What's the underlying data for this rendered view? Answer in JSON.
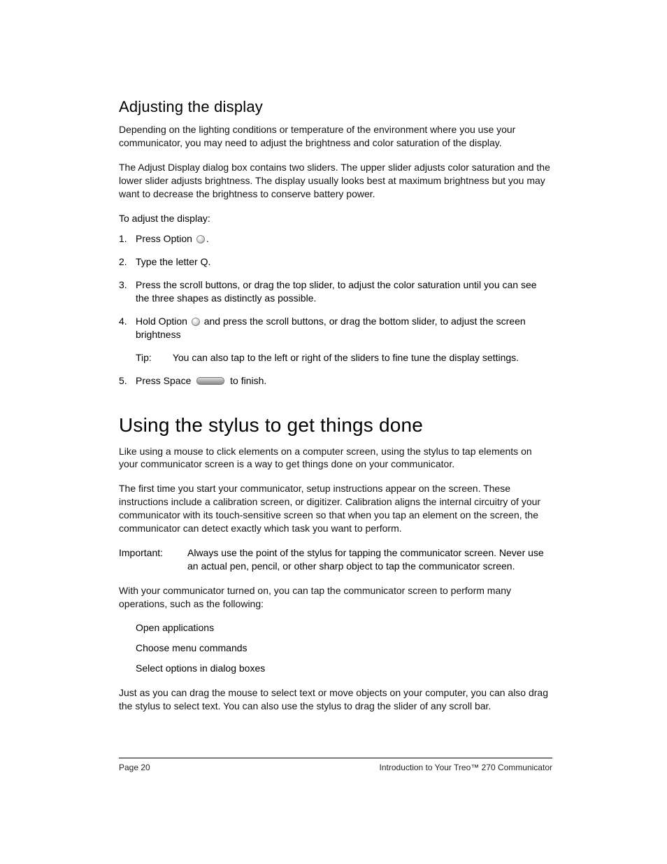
{
  "section": {
    "title": "Adjusting the display",
    "para1": "Depending on the lighting conditions or temperature of the environment where you use your communicator, you may need to adjust the brightness and color saturation of the display.",
    "para2": "The Adjust Display dialog box contains two sliders. The upper slider adjusts color saturation and the lower slider adjusts brightness. The display usually looks best at maximum brightness but you may want to decrease the brightness to conserve battery power.",
    "subhead": "To adjust the display:",
    "steps": {
      "s1a": "Press Option ",
      "s1b": ".",
      "s2": "Type the letter Q.",
      "s3": "Press the scroll buttons, or drag the top slider, to adjust the color saturation until you can see the three shapes as distinctly as possible.",
      "s4a": "Hold Option ",
      "s4b": " and press the scroll buttons, or drag the bottom slider, to adjust the screen brightness",
      "tip_label": "Tip:",
      "tip_text": "You can also tap to the left or right of the sliders to fine tune the display settings.",
      "s5a": "Press Space ",
      "s5b": " to finish."
    }
  },
  "main": {
    "title": "Using the stylus to get things done",
    "para1": "Like using a mouse to click elements on a computer screen, using the stylus to tap elements on your communicator screen is a way to get things done on your communicator.",
    "para2": "The first time you start your communicator, setup instructions appear on the screen. These instructions include a calibration screen, or digitizer. Calibration aligns the internal circuitry of your communicator with its touch-sensitive screen so that when you tap an element on the screen, the communicator can detect exactly which task you want to perform.",
    "note_label": "Important:",
    "note_text": "Always use the point of the stylus for tapping the communicator screen. Never use an actual pen, pencil, or other sharp object to tap the communicator screen.",
    "para3": "With your communicator turned on, you can tap the communicator screen to perform many operations, such as the following:",
    "bullets": {
      "b1": "Open applications",
      "b2": "Choose menu commands",
      "b3": "Select options in dialog boxes"
    },
    "para4": "Just as you can drag the mouse to select text or move objects on your computer, you can also drag the stylus to select text. You can also use the stylus to drag the slider of any scroll bar."
  },
  "footer": {
    "left": "Page 20",
    "right": "Introduction to Your Treo™ 270 Communicator"
  }
}
